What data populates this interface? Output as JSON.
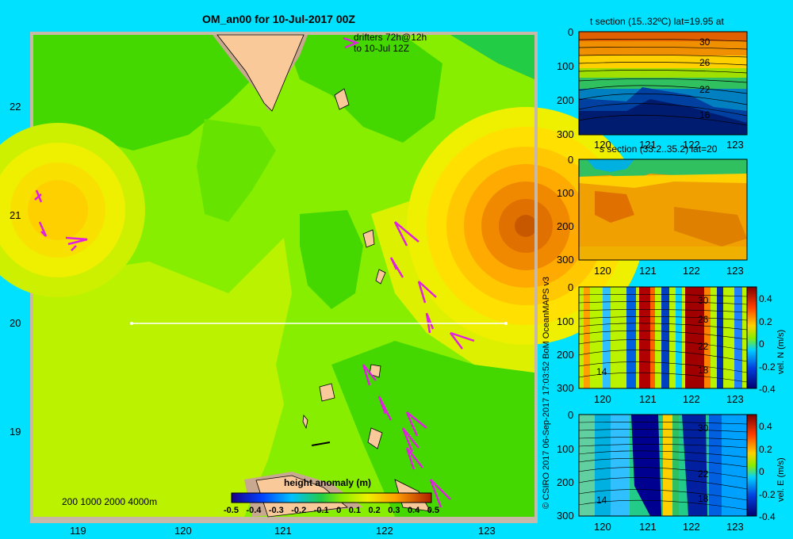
{
  "main_map": {
    "title": "OM_an00 for 10-Jul-2017 00Z",
    "drifters_note_1": "drifters 72h@12h",
    "drifters_note_2": "to 10-Jul 12Z",
    "bathymetry_note": "200 1000 2000 4000m",
    "x_ticks": [
      "119",
      "120",
      "121",
      "122",
      "123"
    ],
    "y_ticks": [
      "22",
      "21",
      "20",
      "19"
    ],
    "colorbar": {
      "title": "height anomaly (m)",
      "ticks": [
        "-0.5",
        "-0.4",
        "-0.3",
        "-0.2",
        "-0.1",
        "0",
        "0.1",
        "0.2",
        "0.3",
        "0.4",
        "0.5"
      ]
    },
    "section_line": {
      "lat": 20,
      "lon_start": 119.5,
      "lon_end": 123.2
    }
  },
  "credit": "© CSIRO 2017   06-Sep-2017 17:03:52 BoM OceanMAPS v3",
  "panels": {
    "t_section": {
      "title": "t section (15..32ºC) lat=19.95 at",
      "y_ticks": [
        "0",
        "100",
        "200",
        "300"
      ],
      "x_ticks": [
        "120",
        "121",
        "122",
        "123"
      ],
      "contour_labels": [
        "30",
        "26",
        "22",
        "16"
      ]
    },
    "s_section": {
      "title": "s section (33.2..35.2) lat=20",
      "y_ticks": [
        "0",
        "100",
        "200",
        "300"
      ],
      "x_ticks": [
        "120",
        "121",
        "122",
        "123"
      ]
    },
    "vn_section": {
      "y_ticks": [
        "0",
        "100",
        "200",
        "300"
      ],
      "x_ticks": [
        "120",
        "121",
        "122",
        "123"
      ],
      "contour_labels": [
        "30",
        "26",
        "22",
        "18",
        "14"
      ],
      "cb_label": "vel. N (m/s)",
      "cb_ticks": [
        "0.4",
        "0.2",
        "0",
        "-0.2",
        "-0.4"
      ]
    },
    "ve_section": {
      "y_ticks": [
        "0",
        "100",
        "200",
        "300"
      ],
      "x_ticks": [
        "120",
        "121",
        "122",
        "123"
      ],
      "contour_labels": [
        "30",
        "22",
        "18",
        "14"
      ],
      "cb_label": "vel. E (m/s)",
      "cb_ticks": [
        "0.4",
        "0.2",
        "0",
        "-0.2",
        "-0.4"
      ]
    }
  },
  "colors": {
    "background": "#00e0ff",
    "land": "#f9c99a",
    "shelf": "#c9a890",
    "drifter": "#e020e0",
    "map_green": "#88ee00"
  }
}
